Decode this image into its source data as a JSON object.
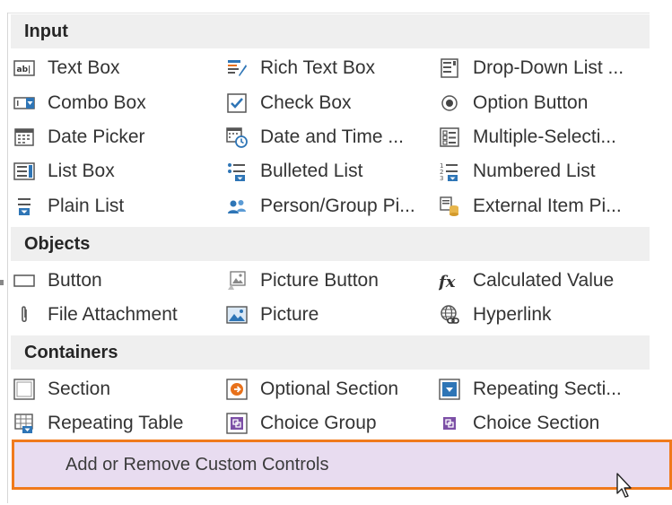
{
  "sections": [
    {
      "title": "Input",
      "items": [
        {
          "label": "Text Box",
          "icon": "text-box-icon"
        },
        {
          "label": "Rich Text Box",
          "icon": "rich-text-box-icon"
        },
        {
          "label": "Drop-Down List ...",
          "icon": "dropdown-list-icon"
        },
        {
          "label": "Combo Box",
          "icon": "combo-box-icon"
        },
        {
          "label": "Check Box",
          "icon": "check-box-icon"
        },
        {
          "label": "Option Button",
          "icon": "option-button-icon"
        },
        {
          "label": "Date Picker",
          "icon": "date-picker-icon"
        },
        {
          "label": "Date and Time ...",
          "icon": "date-time-icon"
        },
        {
          "label": "Multiple-Selecti...",
          "icon": "multiple-selection-icon"
        },
        {
          "label": "List Box",
          "icon": "list-box-icon"
        },
        {
          "label": "Bulleted List",
          "icon": "bulleted-list-icon"
        },
        {
          "label": "Numbered List",
          "icon": "numbered-list-icon"
        },
        {
          "label": "Plain List",
          "icon": "plain-list-icon"
        },
        {
          "label": "Person/Group Pi...",
          "icon": "person-group-icon"
        },
        {
          "label": "External Item Pi...",
          "icon": "external-item-icon"
        }
      ]
    },
    {
      "title": "Objects",
      "items": [
        {
          "label": "Button",
          "icon": "button-icon"
        },
        {
          "label": "Picture Button",
          "icon": "picture-button-icon"
        },
        {
          "label": "Calculated Value",
          "icon": "calculated-value-icon"
        },
        {
          "label": "File Attachment",
          "icon": "paperclip-icon"
        },
        {
          "label": "Picture",
          "icon": "picture-icon"
        },
        {
          "label": "Hyperlink",
          "icon": "hyperlink-icon"
        }
      ]
    },
    {
      "title": "Containers",
      "items": [
        {
          "label": "Section",
          "icon": "section-icon"
        },
        {
          "label": "Optional Section",
          "icon": "optional-section-icon"
        },
        {
          "label": "Repeating Secti...",
          "icon": "repeating-section-icon"
        },
        {
          "label": "Repeating Table",
          "icon": "repeating-table-icon"
        },
        {
          "label": "Choice Group",
          "icon": "choice-group-icon"
        },
        {
          "label": "Choice Section",
          "icon": "choice-section-icon"
        }
      ]
    }
  ],
  "footer": {
    "label": "Add or Remove Custom Controls"
  },
  "colors": {
    "accent": "#f07a1c",
    "highlight": "#e8dcf0",
    "header_bg": "#efefef",
    "icon_blue": "#2e75b6",
    "icon_orange": "#e8711a",
    "icon_purple": "#7c4fa6"
  }
}
